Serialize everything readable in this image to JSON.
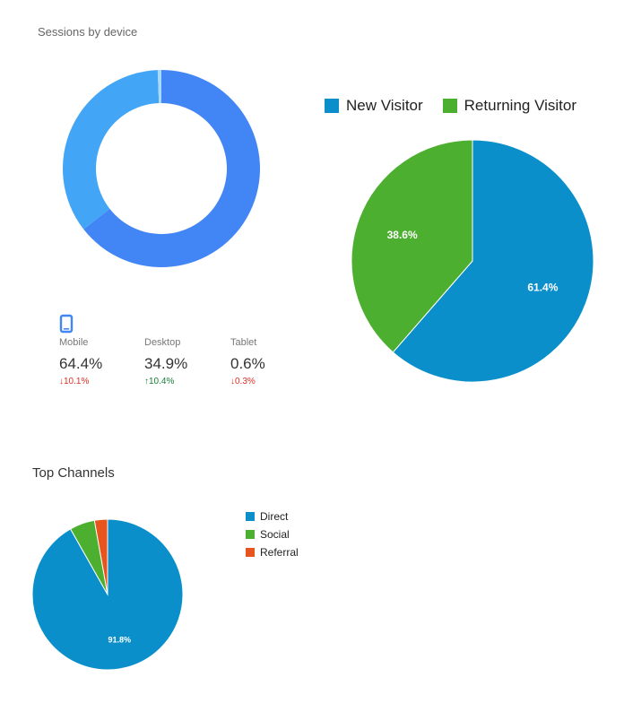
{
  "sessions": {
    "title": "Sessions by device",
    "icon": "mobile-phone-icon",
    "stats": [
      {
        "label": "Mobile",
        "value": "64.4%",
        "change": "10.1%",
        "direction": "down"
      },
      {
        "label": "Desktop",
        "value": "34.9%",
        "change": "10.4%",
        "direction": "up"
      },
      {
        "label": "Tablet",
        "value": "0.6%",
        "change": "0.3%",
        "direction": "down"
      }
    ]
  },
  "visitors": {
    "legend": [
      {
        "label": "New Visitor",
        "color": "#0b8fcb"
      },
      {
        "label": "Returning Visitor",
        "color": "#4caf2f"
      }
    ]
  },
  "channels": {
    "title": "Top Channels",
    "legend": [
      {
        "label": "Direct",
        "color": "#0b8fcb"
      },
      {
        "label": "Social",
        "color": "#4caf2f"
      },
      {
        "label": "Referral",
        "color": "#e8541e"
      }
    ]
  },
  "chart_data": [
    {
      "type": "pie",
      "title": "Sessions by device",
      "style": "donut",
      "categories": [
        "Mobile",
        "Desktop",
        "Tablet"
      ],
      "values": [
        64.4,
        34.9,
        0.6
      ],
      "colors": [
        "#4285f4",
        "#42a5f5",
        "#a8d8fa"
      ]
    },
    {
      "type": "pie",
      "categories": [
        "New Visitor",
        "Returning Visitor"
      ],
      "values": [
        61.4,
        38.6
      ],
      "data_labels": [
        "61.4%",
        "38.6%"
      ],
      "colors": [
        "#0b8fcb",
        "#4caf2f"
      ],
      "legend": "top"
    },
    {
      "type": "pie",
      "title": "Top Channels",
      "categories": [
        "Direct",
        "Social",
        "Referral"
      ],
      "values": [
        91.8,
        5.4,
        2.8
      ],
      "data_labels": [
        "91.8%",
        "",
        ""
      ],
      "colors": [
        "#0b8fcb",
        "#4caf2f",
        "#e8541e"
      ],
      "legend": "right"
    }
  ]
}
